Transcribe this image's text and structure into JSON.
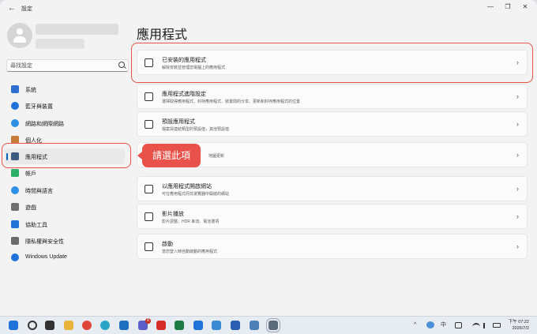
{
  "window": {
    "title": "設定",
    "back_symbol": "←",
    "minimize_symbol": "—",
    "maximize_symbol": "❐",
    "close_symbol": "✕"
  },
  "sidebar": {
    "search_placeholder": "尋找設定",
    "items": [
      {
        "label": "系統",
        "icon": "system-icon",
        "color": "#2f6fd1"
      },
      {
        "label": "藍牙與裝置",
        "icon": "bluetooth-icon",
        "color": "#1f73d8"
      },
      {
        "label": "網路和網際網路",
        "icon": "network-icon",
        "color": "#2d8fe6"
      },
      {
        "label": "個人化",
        "icon": "personalization-icon",
        "color": "#c77b3b"
      },
      {
        "label": "應用程式",
        "icon": "apps-icon",
        "color": "#3d5a80",
        "selected": true
      },
      {
        "label": "帳戶",
        "icon": "accounts-icon",
        "color": "#2bae66"
      },
      {
        "label": "時間與語言",
        "icon": "time-language-icon",
        "color": "#2d8fe6"
      },
      {
        "label": "遊戲",
        "icon": "gaming-icon",
        "color": "#707070"
      },
      {
        "label": "協助工具",
        "icon": "accessibility-icon",
        "color": "#1f73d8"
      },
      {
        "label": "隱私權與安全性",
        "icon": "privacy-shield-icon",
        "color": "#6b6b6b"
      },
      {
        "label": "Windows Update",
        "icon": "windows-update-icon",
        "color": "#1f73d8"
      }
    ]
  },
  "main": {
    "title": "應用程式",
    "chevron": "›",
    "cards": [
      {
        "title": "已安裝的應用程式",
        "desc": "解除安裝並管理您電腦上的應用程式",
        "icon": "installed-apps-icon"
      },
      {
        "title": "應用程式進階設定",
        "desc": "選擇取得應用程式、封存應用程式、裝置間的分享、更新和封存應用程式的位置",
        "icon": "advanced-app-settings-icon"
      },
      {
        "title": "預設應用程式",
        "desc": "檔案與連結類型的預設值，其他預設值",
        "icon": "default-apps-icon"
      },
      {
        "title": "",
        "desc": "地圖更新",
        "icon": "offline-maps-icon"
      },
      {
        "title": "以應用程式開啟網站",
        "desc": "可在應用程式而非瀏覽器中開啟的網站",
        "icon": "apps-for-websites-icon"
      },
      {
        "title": "影片播放",
        "desc": "影片調整、HDR 串流、電池選項",
        "icon": "video-playback-icon"
      },
      {
        "title": "啟動",
        "desc": "當您登入時自動啟動的應用程式",
        "icon": "startup-icon"
      }
    ]
  },
  "callout": {
    "text": "請選此項"
  },
  "taskbar": {
    "apps": [
      {
        "icon": "start-windows-icon",
        "color": "#1f73d8"
      },
      {
        "icon": "search-icon",
        "color": "#333333"
      },
      {
        "icon": "task-view-icon",
        "color": "#333333"
      },
      {
        "icon": "file-explorer-icon",
        "color": "#e8b43a"
      },
      {
        "icon": "chrome-icon",
        "color": "#e0453a"
      },
      {
        "icon": "edge-icon",
        "color": "#2aa5c8"
      },
      {
        "icon": "outlook-icon",
        "color": "#1f6fbf"
      },
      {
        "icon": "teams-icon",
        "color": "#5b5fc7"
      },
      {
        "icon": "acrobat-icon",
        "color": "#d62b2b"
      },
      {
        "icon": "excel-icon",
        "color": "#1e7a45"
      },
      {
        "icon": "outlook-new-icon",
        "color": "#1f73d8"
      },
      {
        "icon": "photos-icon",
        "color": "#3a8ad6"
      },
      {
        "icon": "word-icon",
        "color": "#2b5fb3"
      },
      {
        "icon": "calculator-icon",
        "color": "#4a7fb8"
      },
      {
        "icon": "settings-icon",
        "color": "#5b6b7b"
      }
    ],
    "teams_badge": "8",
    "tray": {
      "chevron_up": "^",
      "ime_mode": "中",
      "clock_time": "下午 07:22",
      "clock_date": "2026/7/2"
    }
  }
}
